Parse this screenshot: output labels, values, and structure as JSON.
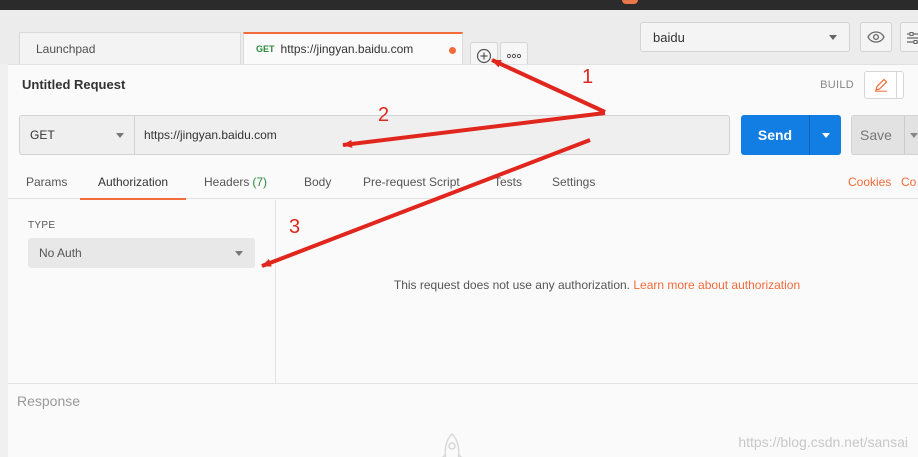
{
  "tabs": {
    "launchpad_label": "Launchpad",
    "active_method": "GET",
    "active_url": "https://jingyan.baidu.com"
  },
  "environment": {
    "selected": "baidu"
  },
  "request": {
    "title": "Untitled Request",
    "build_label": "BUILD",
    "method": "GET",
    "url": "https://jingyan.baidu.com",
    "send_label": "Send",
    "save_label": "Save"
  },
  "request_tabs": {
    "params": "Params",
    "authorization": "Authorization",
    "headers": "Headers",
    "headers_count": "(7)",
    "body": "Body",
    "prerequest": "Pre-request Script",
    "tests": "Tests",
    "settings": "Settings",
    "cookies": "Cookies",
    "code": "Co"
  },
  "auth": {
    "type_label": "TYPE",
    "type_value": "No Auth",
    "message": "This request does not use any authorization.",
    "learn_more": "Learn more about authorization"
  },
  "response": {
    "label": "Response"
  },
  "watermark": "https://blog.csdn.net/sansai",
  "annotations": [
    "1",
    "2",
    "3"
  ],
  "colors": {
    "accent": "#f26b3a",
    "send": "#127ee3",
    "annotation": "#e0261d"
  }
}
